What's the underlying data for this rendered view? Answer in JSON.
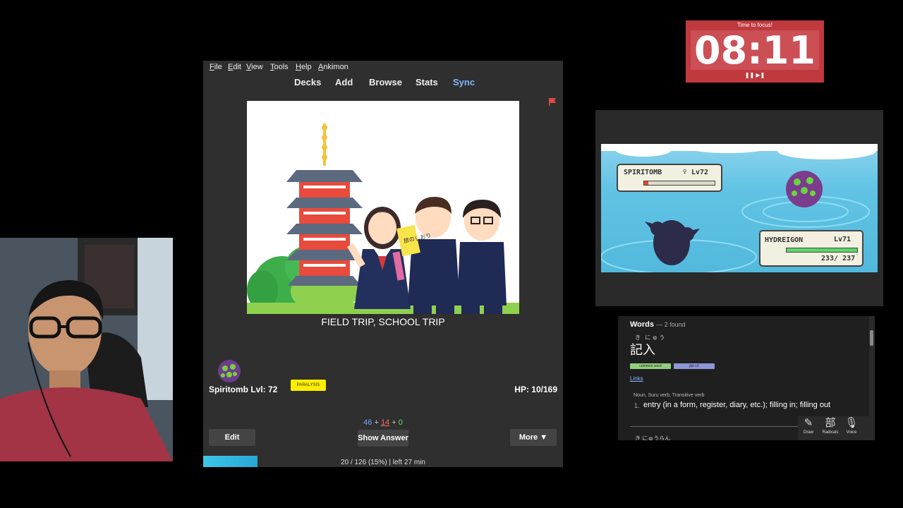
{
  "anki": {
    "menu": [
      "File",
      "Edit",
      "View",
      "Tools",
      "Help",
      "Ankimon"
    ],
    "toolbar": {
      "decks": "Decks",
      "add": "Add",
      "browse": "Browse",
      "stats": "Stats",
      "sync": "Sync"
    },
    "card": {
      "answer": "FIELD TRIP, SCHOOL TRIP",
      "sign_text": "旅のしおり"
    },
    "pet": {
      "name": "Spiritomb Lvl: 72",
      "status": "PARALYSIS",
      "hp": "HP: 10/169"
    },
    "counts": {
      "new": "46",
      "learn": "14",
      "review": "0",
      "plus": "+"
    },
    "buttons": {
      "edit": "Edit",
      "show_answer": "Show Answer",
      "more": "More ▼"
    },
    "progress": {
      "fraction": 0.15,
      "text": "20 / 126 (15%) | left 27 min"
    }
  },
  "timer": {
    "title": "Time to focus!",
    "time": "08:11",
    "controls": "❚❚ ▶❚"
  },
  "game": {
    "enemy": {
      "name": "SPIRITOMB",
      "gender": "♀",
      "level": "Lv72",
      "hp_fraction": 0.06
    },
    "player": {
      "name": "HYDREIGON",
      "level": "Lv71",
      "hp_fraction": 1.0,
      "hp": "233/ 237"
    }
  },
  "dictionary": {
    "title": "Words",
    "found": "— 2 found",
    "furigana": "き にゅう",
    "word": "記入",
    "tags": [
      {
        "label": "common word",
        "color": "#8fcf7a"
      },
      {
        "label": "jlpt n3",
        "color": "#8c96d8"
      }
    ],
    "links": "Links",
    "pos": "Noun, Suru verb, Transitive verb",
    "sense_num": "1.",
    "sense": "entry (in a form, register, diary, etc.); filling in; filling out",
    "next_furigana": "き にゅうらん",
    "tools": [
      {
        "icon": "✎",
        "label": "Draw"
      },
      {
        "icon": "部",
        "label": "Radicals"
      },
      {
        "icon": "🎙",
        "label": "Voice"
      }
    ]
  }
}
